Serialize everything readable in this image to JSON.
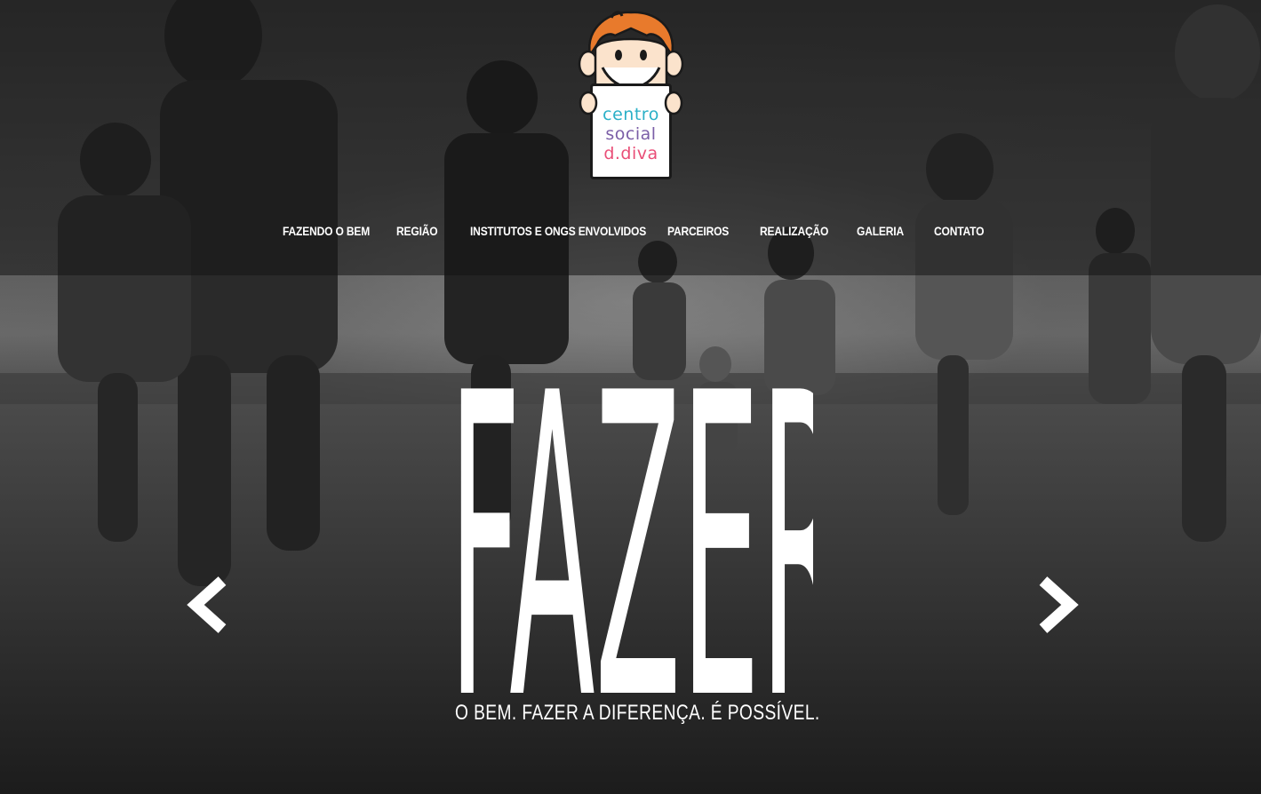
{
  "logo": {
    "line1": "centro",
    "line2": "social",
    "line3": "d.diva",
    "colors": [
      "#2bb0c7",
      "#f28c1f",
      "#8bc34a",
      "#e94e77",
      "#7b5ea7",
      "#2e9ad0"
    ]
  },
  "nav": {
    "items": [
      {
        "label": "FAZENDO O BEM"
      },
      {
        "label": "REGIÃO"
      },
      {
        "label": "INSTITUTOS E ONGS ENVOLVIDOS"
      },
      {
        "label": "PARCEIROS"
      },
      {
        "label": "REALIZAÇÃO"
      },
      {
        "label": "GALERIA"
      },
      {
        "label": "CONTATO"
      }
    ]
  },
  "hero": {
    "headline": "FAZER",
    "tagline": "O BEM. FAZER A DIFERENÇA. É POSSÍVEL.",
    "prev_icon": "chevron-left-icon",
    "next_icon": "chevron-right-icon"
  }
}
